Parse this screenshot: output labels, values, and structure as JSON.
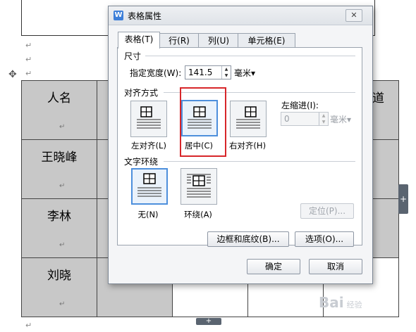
{
  "document": {
    "names": [
      "人名",
      "王晓峰",
      "李林",
      "刘晓"
    ],
    "partial_header": "道",
    "para_mark": "↵",
    "handle_plus": "+"
  },
  "dialog": {
    "title": "表格属性",
    "app_icon": "W",
    "close": "✕",
    "tabs": [
      {
        "label": "表格(T)",
        "active": true
      },
      {
        "label": "行(R)",
        "active": false
      },
      {
        "label": "列(U)",
        "active": false
      },
      {
        "label": "单元格(E)",
        "active": false
      }
    ],
    "size": {
      "group": "尺寸",
      "width_label": "指定宽度(W):",
      "width_value": "141.5",
      "unit": "毫米▾"
    },
    "align": {
      "group": "对齐方式",
      "options": [
        {
          "label": "左对齐(L)",
          "icon": "align-left-icon",
          "selected": false
        },
        {
          "label": "居中(C)",
          "icon": "align-center-icon",
          "selected": true
        },
        {
          "label": "右对齐(H)",
          "icon": "align-right-icon",
          "selected": false
        }
      ],
      "indent_label": "左缩进(I):",
      "indent_value": "0",
      "indent_unit": "毫米▾"
    },
    "wrap": {
      "group": "文字环绕",
      "options": [
        {
          "label": "无(N)",
          "icon": "wrap-none-icon",
          "selected": true
        },
        {
          "label": "环绕(A)",
          "icon": "wrap-around-icon",
          "selected": false
        }
      ],
      "position_button": "定位(P)..."
    },
    "borders_button": "边框和底纹(B)...",
    "options_button": "选项(O)...",
    "ok_button": "确定",
    "cancel_button": "取消"
  },
  "watermark": {
    "text": "Bai",
    "suffix": "经验"
  },
  "colors": {
    "accent": "#4d8fdc",
    "highlight": "#d7262a",
    "cell_gray": "#c8c8c8"
  }
}
